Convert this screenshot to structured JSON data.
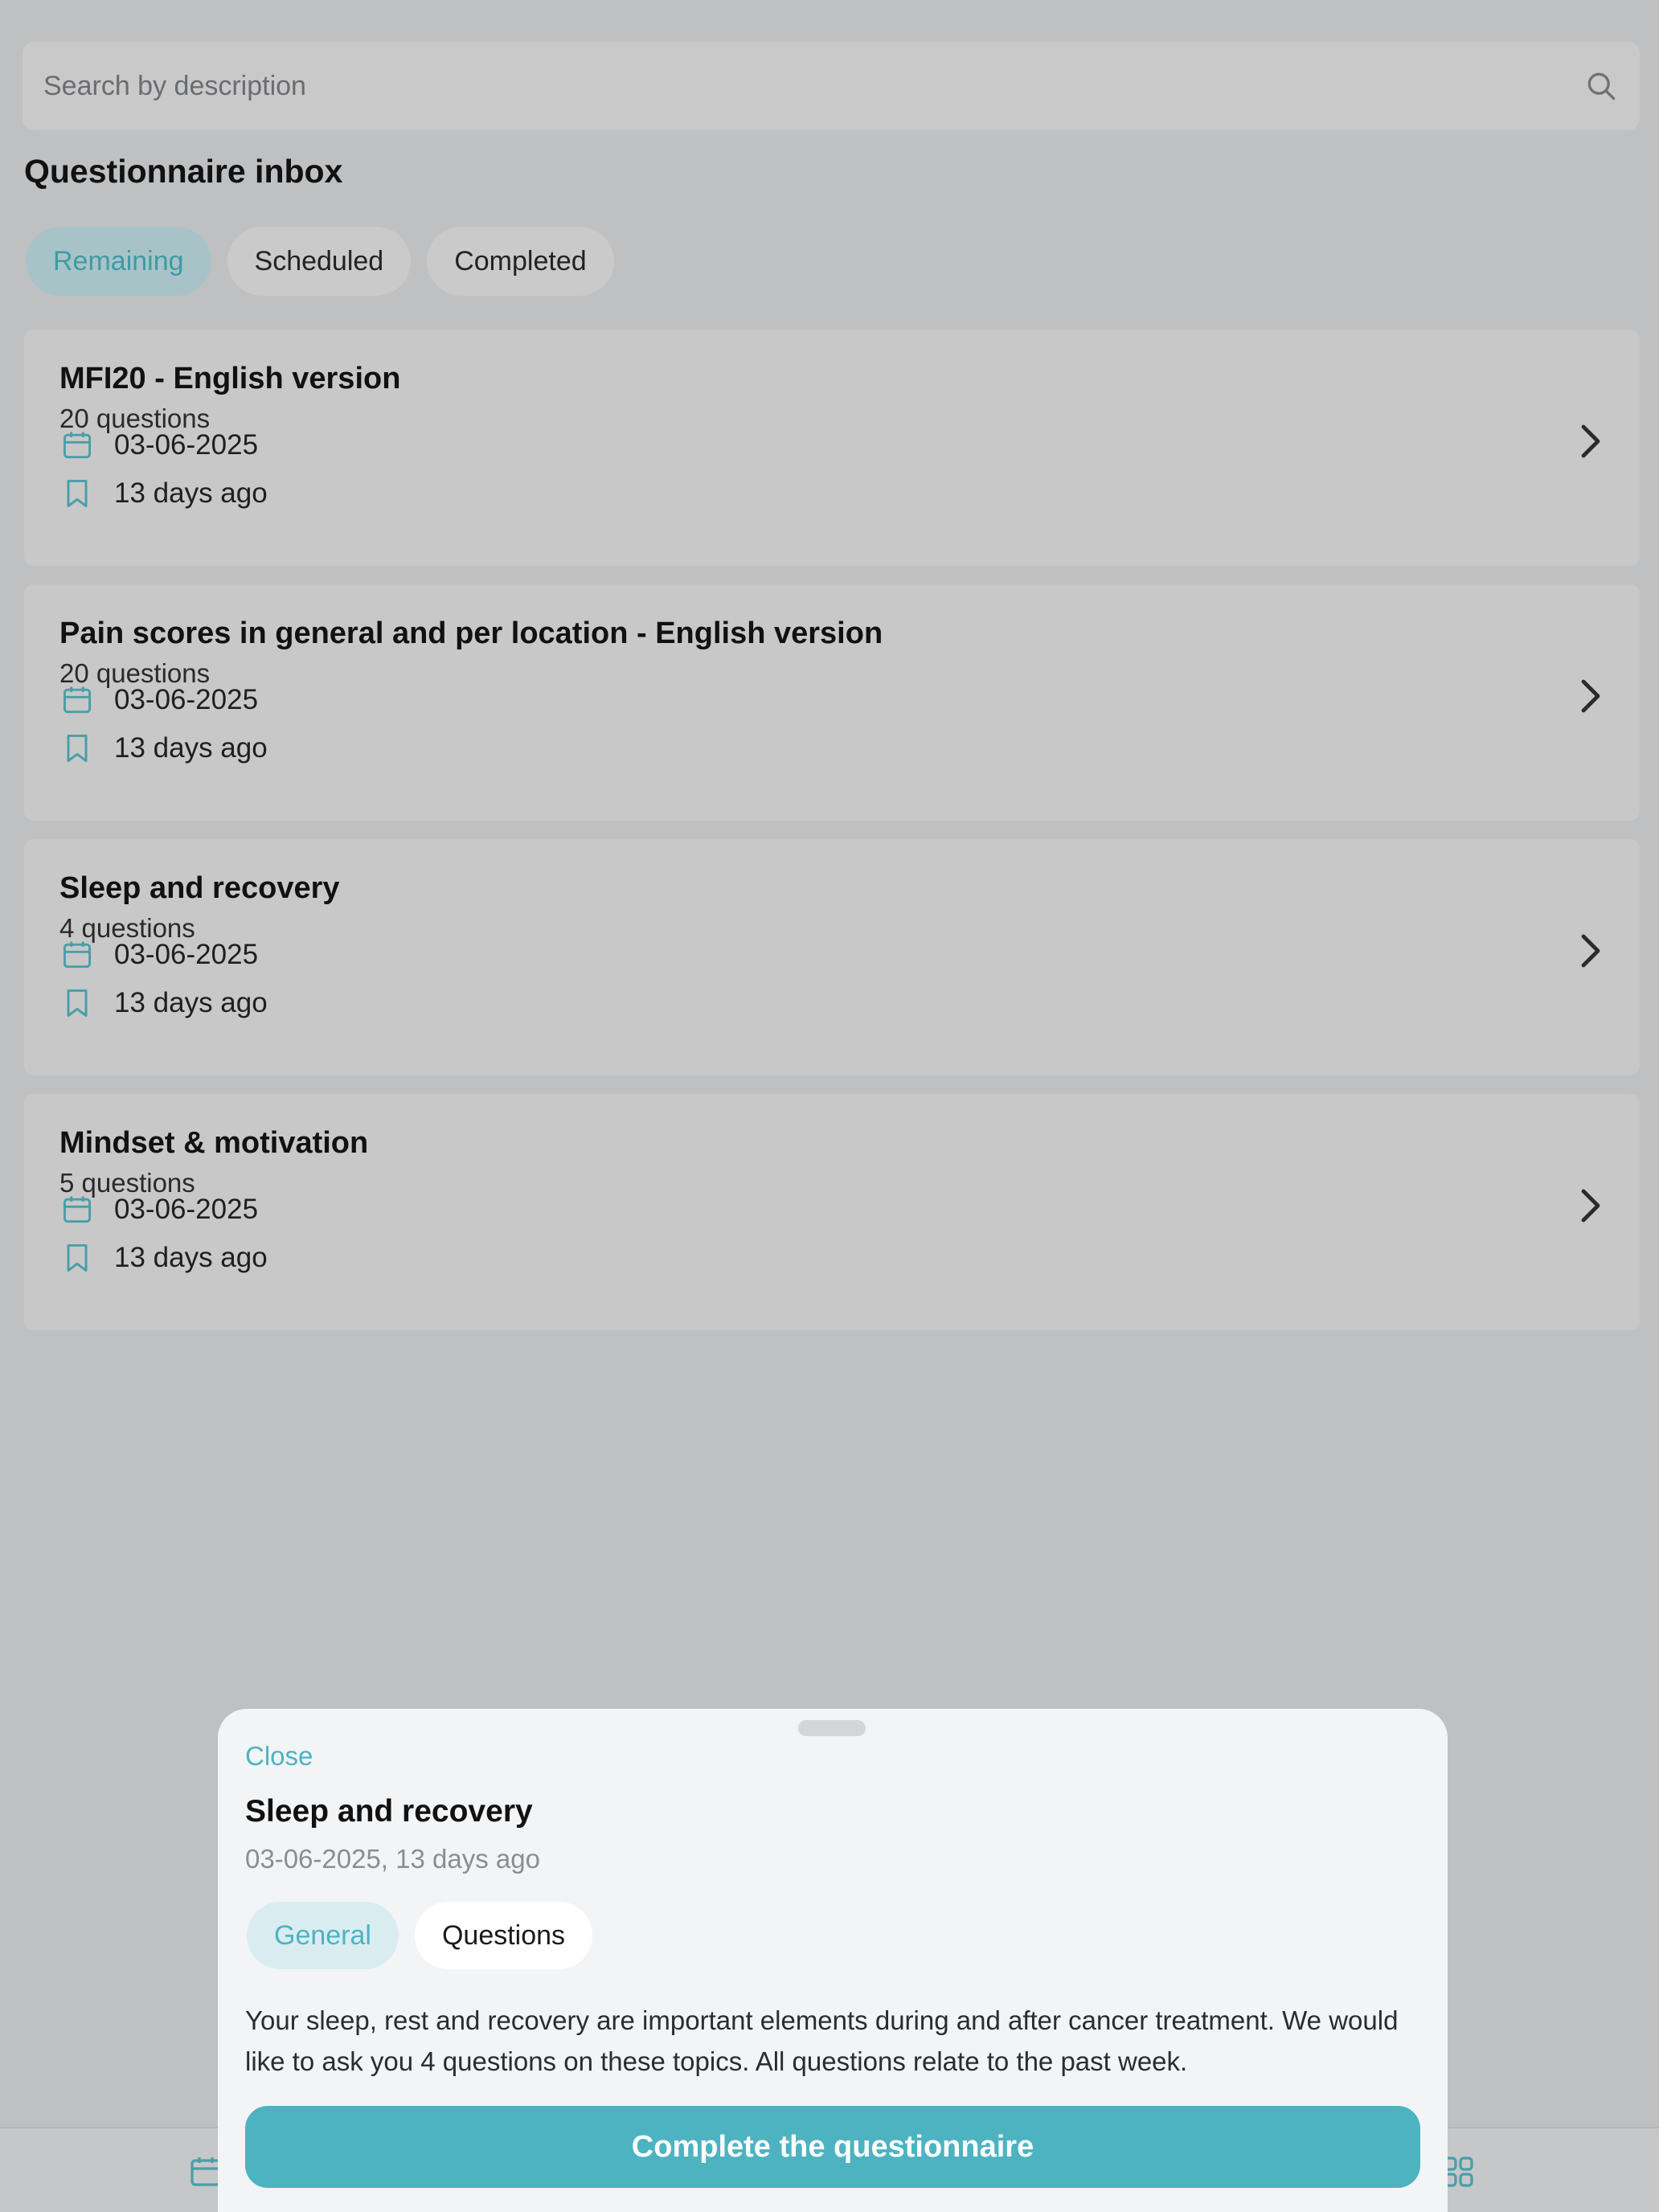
{
  "search": {
    "placeholder": "Search by description",
    "icon": "search-icon"
  },
  "inbox": {
    "title": "Questionnaire inbox"
  },
  "tabs": [
    {
      "label": "Remaining",
      "active": true
    },
    {
      "label": "Scheduled",
      "active": false
    },
    {
      "label": "Completed",
      "active": false
    }
  ],
  "questionnaires": [
    {
      "title": "MFI20 - English version",
      "count": "20 questions",
      "date": "03-06-2025",
      "ago": "13 days ago"
    },
    {
      "title": "Pain scores in general and per location - English version",
      "count": "20 questions",
      "date": "03-06-2025",
      "ago": "13 days ago"
    },
    {
      "title": "Sleep and recovery",
      "count": "4 questions",
      "date": "03-06-2025",
      "ago": "13 days ago"
    },
    {
      "title": "Mindset & motivation",
      "count": "5 questions",
      "date": "03-06-2025",
      "ago": "13 days ago"
    }
  ],
  "sheet": {
    "close_label": "Close",
    "title": "Sleep and recovery",
    "subtitle": "03-06-2025, 13 days ago",
    "tabs": [
      {
        "label": "General",
        "active": true
      },
      {
        "label": "Questions",
        "active": false
      }
    ],
    "description": "Your sleep, rest and recovery are important elements during and after cancer treatment. We would like to ask you 4 questions on these topics. All questions relate to the past week.",
    "cta_label": "Complete the questionnaire"
  },
  "colors": {
    "accent": "#4db3c1",
    "overlay_background": "#bfc0c2",
    "card_background": "#c8c8c8",
    "sheet_background": "#f3f4f6"
  },
  "icons": {
    "date": "calendar-icon",
    "ago": "bookmark-icon",
    "row_action": "chevron-right-icon"
  }
}
